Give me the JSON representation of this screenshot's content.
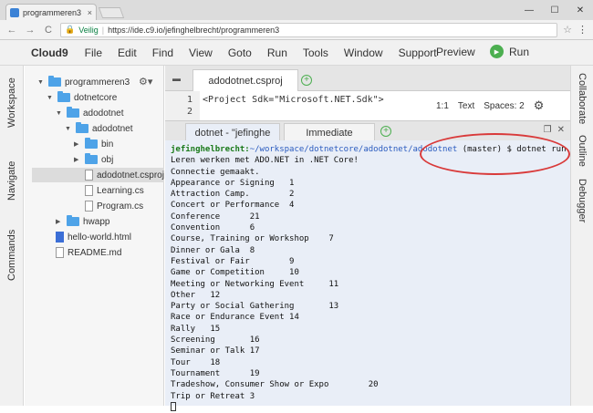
{
  "browser": {
    "tab_title": "programmeren3 - Cloud9",
    "tab_close": "×",
    "nav_back": "←",
    "nav_forward": "→",
    "nav_reload": "C",
    "secure_label": "Veilig",
    "url": "https://ide.c9.io/jefinghelbrecht/programmeren3",
    "window_buttons": [
      "—",
      "☐",
      "✕"
    ]
  },
  "menubar": {
    "brand": "Cloud9",
    "items": [
      "File",
      "Edit",
      "Find",
      "View",
      "Goto",
      "Run",
      "Tools",
      "Window",
      "Support"
    ],
    "preview": "Preview",
    "run": "Run"
  },
  "left_rail": [
    "Workspace",
    "Navigate",
    "Commands"
  ],
  "right_rail": [
    "Collaborate",
    "Outline",
    "Debugger"
  ],
  "tree": {
    "items": [
      {
        "label": "programmeren3",
        "type": "folder"
      },
      {
        "label": "dotnetcore",
        "type": "folder"
      },
      {
        "label": "adodotnet",
        "type": "folder"
      },
      {
        "label": "adodotnet",
        "type": "folder"
      },
      {
        "label": "bin",
        "type": "folder"
      },
      {
        "label": "obj",
        "type": "folder"
      },
      {
        "label": "adodotnet.csproj",
        "type": "file"
      },
      {
        "label": "Learning.cs",
        "type": "file"
      },
      {
        "label": "Program.cs",
        "type": "file"
      },
      {
        "label": "hwapp",
        "type": "folder"
      },
      {
        "label": "hello-world.html",
        "type": "html"
      },
      {
        "label": "README.md",
        "type": "file"
      }
    ]
  },
  "editor": {
    "tab": "adodotnet.csproj",
    "lines": [
      "<Project Sdk=\"Microsoft.NET.Sdk\">",
      ""
    ],
    "status": {
      "position": "1:1",
      "mode": "Text",
      "spaces": "Spaces: 2"
    }
  },
  "terminal": {
    "tabs": [
      "dotnet - \"jefinghe",
      "Immediate"
    ],
    "prompt_user": "jefinghelbrecht:",
    "prompt_path": "~/workspace/dotnetcore/adodotnet/adodotnet",
    "prompt_rest": " (master) $ dotnet run",
    "output": [
      "Leren werken met ADO.NET in .NET Core!",
      "Connectie gemaakt.",
      "Appearance or Signing   1",
      "Attraction Camp.        2",
      "Concert or Performance  4",
      "Conference      21",
      "Convention      6",
      "Course, Training or Workshop    7",
      "Dinner or Gala  8",
      "Festival or Fair        9",
      "Game or Competition     10",
      "Meeting or Networking Event     11",
      "Other   12",
      "Party or Social Gathering       13",
      "Race or Endurance Event 14",
      "Rally   15",
      "Screening       16",
      "Seminar or Talk 17",
      "Tour    18",
      "Tournament      19",
      "Tradeshow, Consumer Show or Expo        20",
      "Trip or Retreat 3"
    ]
  },
  "colors": {
    "accent_green": "#4caf50",
    "folder_blue": "#4ea3e8",
    "annotation_red": "#d93a3a"
  }
}
